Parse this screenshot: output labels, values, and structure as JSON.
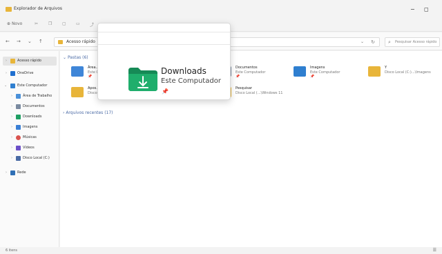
{
  "window": {
    "title": "Explorador de Arquivos",
    "minimize": "−",
    "maximize": "◻"
  },
  "commandbar": {
    "new_label": "Novo",
    "new_icon": "plus-icon"
  },
  "address": {
    "back": "←",
    "forward": "→",
    "recent": "⌄",
    "up": "↑",
    "path": "Acesso rápido",
    "dropdown": "⌄",
    "refresh": "↻"
  },
  "search": {
    "placeholder": "Pesquisar Acesso rápido"
  },
  "sidebar": {
    "items": [
      {
        "label": "Acesso rápido",
        "color": "#e8b53a"
      },
      {
        "label": "OneDrive",
        "color": "#1f6fcf"
      },
      {
        "label": "Este Computador",
        "color": "#2f7fd0"
      },
      {
        "label": "Área de Trabalho",
        "color": "#4a90d9"
      },
      {
        "label": "Documentos",
        "color": "#7a8aa0"
      },
      {
        "label": "Downloads",
        "color": "#1f9f63"
      },
      {
        "label": "Imagens",
        "color": "#3a7fd5"
      },
      {
        "label": "Músicas",
        "color": "#d9534f"
      },
      {
        "label": "Vídeos",
        "color": "#6b4fc8"
      },
      {
        "label": "Disco Local (C:)",
        "color": "#4a6aa5"
      },
      {
        "label": "Rede",
        "color": "#2f6fb5"
      }
    ]
  },
  "content": {
    "pastas_header": "Pastas (6)",
    "recentes_header": "Arquivos recentes (17)",
    "tiles": [
      {
        "name": "Área...",
        "sub": "Este C...",
        "pin": "📌",
        "color": "#3f86d8"
      },
      {
        "name": "Documentos",
        "sub": "Este Computador",
        "pin": "📌",
        "color": "#7a8aa0"
      },
      {
        "name": "Imagens",
        "sub": "Este Computador",
        "pin": "📌",
        "color": "#2f7fd0"
      },
      {
        "name": "Y",
        "sub": "Disco Local (C:)...\\Imagens",
        "pin": "",
        "color": "#e8b53a"
      },
      {
        "name": "Apos...",
        "sub": "Disco...",
        "pin": "",
        "color": "#e8b53a"
      },
      {
        "name": "Pesquisar",
        "sub": "Disco Local (...\\Windows 11",
        "pin": "",
        "color": "#e8b53a"
      }
    ]
  },
  "popup": {
    "title": "Downloads",
    "subtitle": "Este Computador",
    "pin": "📌",
    "folder_color": "#1f9f63",
    "arrow": "↓"
  },
  "statusbar": {
    "items": "6 itens"
  }
}
